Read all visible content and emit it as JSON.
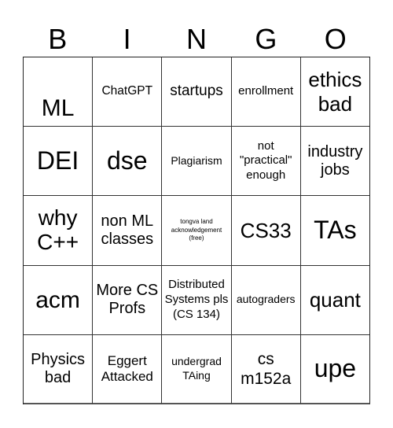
{
  "header": {
    "letters": [
      "B",
      "I",
      "N",
      "G",
      "O"
    ]
  },
  "board": {
    "cells": [
      "ML",
      "ChatGPT",
      "startups",
      "enrollment",
      "ethics bad",
      "DEI",
      "dse",
      "Plagiarism",
      "not \"practical\" enough",
      "industry jobs",
      "why C++",
      "non ML classes",
      "tongva land acknowledgement (free)",
      "CS33",
      "TAs",
      "acm",
      "More CS Profs",
      "Distributed Systems pls (CS 134)",
      "autograders",
      "quant",
      "Physics bad",
      "Eggert Attacked",
      "undergrad TAing",
      "cs m152a",
      "upe"
    ]
  }
}
